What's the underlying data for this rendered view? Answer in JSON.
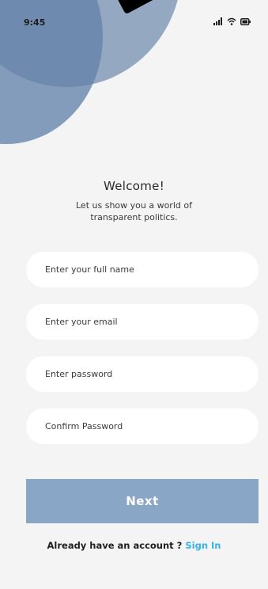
{
  "status_bar": {
    "time": "9:45",
    "icons": [
      "signal-icon",
      "wifi-icon",
      "battery-icon"
    ]
  },
  "welcome": {
    "title": "Welcome!",
    "subtitle": "Let us show you a world of transparent politics."
  },
  "form": {
    "full_name_placeholder": "Enter your full name",
    "email_placeholder": "Enter your email",
    "password_placeholder": "Enter password",
    "confirm_password_placeholder": "Confirm Password"
  },
  "next_button": {
    "label": "Next"
  },
  "footer": {
    "prompt": "Already have an account ?",
    "sign_in_label": "Sign In"
  },
  "colors": {
    "background": "#f4f4f4",
    "circle_light": "#94a8c1",
    "circle_dark": "#6483aa",
    "button": "#8aa6c7",
    "link": "#35b4e4"
  }
}
